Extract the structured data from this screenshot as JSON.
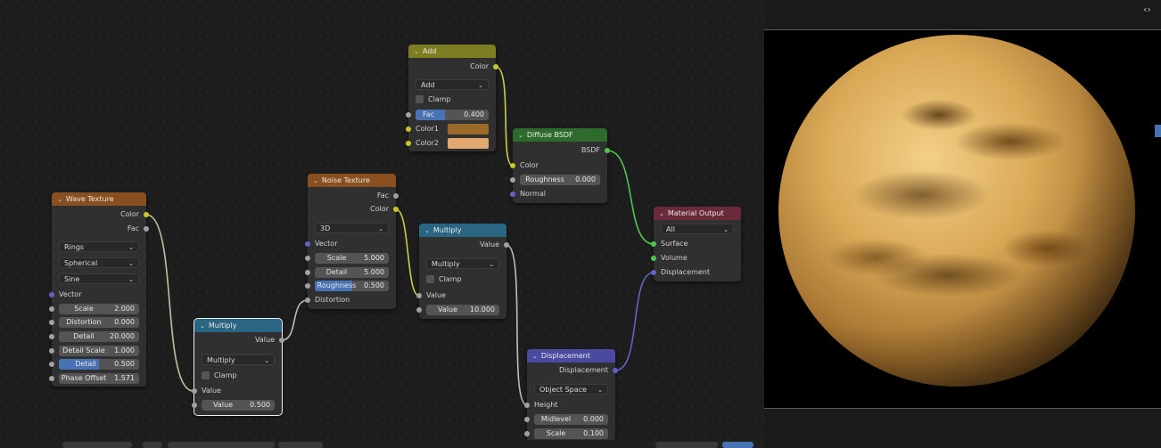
{
  "viewport": {
    "collapse_icon": "‹›",
    "expand_icon": "‹›"
  },
  "nodes": {
    "wave": {
      "title": "Wave Texture",
      "out_color": "Color",
      "out_fac": "Fac",
      "type": "Rings",
      "direction": "Spherical",
      "profile": "Sine",
      "vector": "Vector",
      "fields": [
        {
          "name": "Scale",
          "value": "2.000"
        },
        {
          "name": "Distortion",
          "value": "0.000"
        },
        {
          "name": "Detail",
          "value": "20.000"
        },
        {
          "name": "Detail Scale",
          "value": "1.000"
        },
        {
          "name": "Detail Roughness",
          "value": "0.500",
          "fill": 0.5
        },
        {
          "name": "Phase Offset",
          "value": "1.571"
        }
      ]
    },
    "mult1": {
      "title": "Multiply",
      "out_value": "Value",
      "operation": "Multiply",
      "clamp": "Clamp",
      "in_value": "Value",
      "field": {
        "name": "Value",
        "value": "0.500"
      }
    },
    "noise": {
      "title": "Noise Texture",
      "out_fac": "Fac",
      "out_color": "Color",
      "dimensions": "3D",
      "vector": "Vector",
      "fields": [
        {
          "name": "Scale",
          "value": "5.000"
        },
        {
          "name": "Detail",
          "value": "5.000"
        },
        {
          "name": "Roughness",
          "value": "0.500",
          "fill": 0.5
        }
      ],
      "distortion": "Distortion"
    },
    "mult2": {
      "title": "Multiply",
      "out_value": "Value",
      "operation": "Multiply",
      "clamp": "Clamp",
      "in_value": "Value",
      "field": {
        "name": "Value",
        "value": "10.000"
      }
    },
    "add": {
      "title": "Add",
      "out_color": "Color",
      "blend": "Add",
      "clamp": "Clamp",
      "fac": {
        "name": "Fac",
        "value": "0.400",
        "fill": 0.4
      },
      "color1": "Color1",
      "color2": "Color2",
      "color1_hex": "#9a6a2a",
      "color2_hex": "#e0a870"
    },
    "diffuse": {
      "title": "Diffuse BSDF",
      "out_bsdf": "BSDF",
      "in_color": "Color",
      "field": {
        "name": "Roughness",
        "value": "0.000"
      },
      "normal": "Normal"
    },
    "output": {
      "title": "Material Output",
      "target": "All",
      "surface": "Surface",
      "volume": "Volume",
      "displacement": "Displacement"
    },
    "disp": {
      "title": "Displacement",
      "out_disp": "Displacement",
      "space": "Object Space",
      "height": "Height",
      "fields": [
        {
          "name": "Midlevel",
          "value": "0.000"
        },
        {
          "name": "Scale",
          "value": "0.100"
        }
      ]
    }
  },
  "colors": {
    "texture_header": "#8a4f1f",
    "converter_header": "#2a6583",
    "shader_header": "#2d6b2d",
    "output_header": "#6b2a39",
    "vector_header": "#4a4aa0",
    "color_header": "#7d7d22",
    "selection": "#f0f0f0",
    "slider": "#4772b3"
  }
}
